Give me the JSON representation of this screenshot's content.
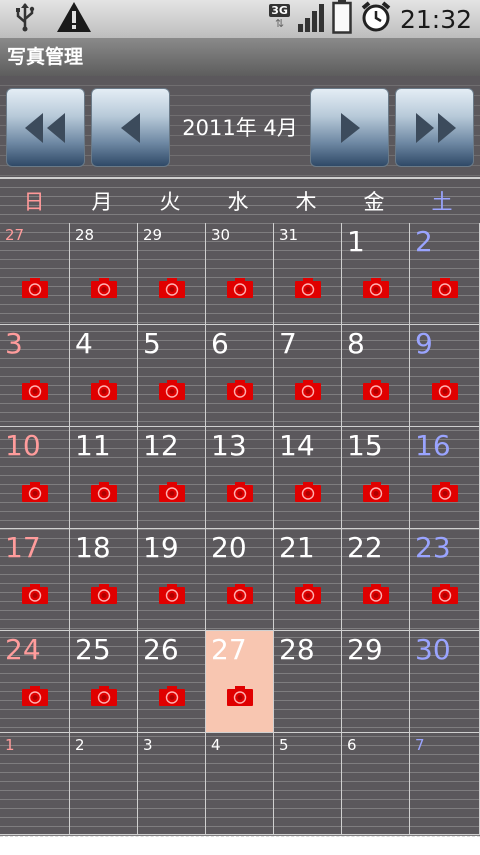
{
  "status_bar": {
    "icons": [
      "usb-icon",
      "warning-icon",
      "signal-icon",
      "battery-icon",
      "alarm-icon"
    ],
    "network": "3G",
    "time": "21:32"
  },
  "app": {
    "title": "写真管理"
  },
  "nav": {
    "month_label": "2011年 4月",
    "buttons": [
      "prev-year",
      "prev-month",
      "next-month",
      "next-year"
    ]
  },
  "calendar": {
    "weekdays": [
      "日",
      "月",
      "火",
      "水",
      "木",
      "金",
      "土"
    ],
    "colors": {
      "sunday": "#ff9c9c",
      "saturday": "#9aa4ff",
      "today_bg": "#f8c6b1",
      "camera": "#e00000"
    },
    "weeks": [
      [
        {
          "day": "27",
          "other": true,
          "photo": true
        },
        {
          "day": "28",
          "other": true,
          "photo": true
        },
        {
          "day": "29",
          "other": true,
          "photo": true
        },
        {
          "day": "30",
          "other": true,
          "photo": true
        },
        {
          "day": "31",
          "other": true,
          "photo": true
        },
        {
          "day": "1",
          "photo": true
        },
        {
          "day": "2",
          "photo": true
        }
      ],
      [
        {
          "day": "3",
          "photo": true
        },
        {
          "day": "4",
          "photo": true
        },
        {
          "day": "5",
          "photo": true
        },
        {
          "day": "6",
          "photo": true
        },
        {
          "day": "7",
          "photo": true
        },
        {
          "day": "8",
          "photo": true
        },
        {
          "day": "9",
          "photo": true
        }
      ],
      [
        {
          "day": "10",
          "photo": true
        },
        {
          "day": "11",
          "photo": true
        },
        {
          "day": "12",
          "photo": true
        },
        {
          "day": "13",
          "photo": true
        },
        {
          "day": "14",
          "photo": true
        },
        {
          "day": "15",
          "photo": true
        },
        {
          "day": "16",
          "photo": true
        }
      ],
      [
        {
          "day": "17",
          "photo": true
        },
        {
          "day": "18",
          "photo": true
        },
        {
          "day": "19",
          "photo": true
        },
        {
          "day": "20",
          "photo": true
        },
        {
          "day": "21",
          "photo": true
        },
        {
          "day": "22",
          "photo": true
        },
        {
          "day": "23",
          "photo": true
        }
      ],
      [
        {
          "day": "24",
          "photo": true
        },
        {
          "day": "25",
          "photo": true
        },
        {
          "day": "26",
          "photo": true
        },
        {
          "day": "27",
          "photo": true,
          "today": true
        },
        {
          "day": "28",
          "photo": false
        },
        {
          "day": "29",
          "photo": false
        },
        {
          "day": "30",
          "photo": false
        }
      ],
      [
        {
          "day": "1",
          "other": true,
          "photo": false
        },
        {
          "day": "2",
          "other": true,
          "photo": false
        },
        {
          "day": "3",
          "other": true,
          "photo": false
        },
        {
          "day": "4",
          "other": true,
          "photo": false
        },
        {
          "day": "5",
          "other": true,
          "photo": false
        },
        {
          "day": "6",
          "other": true,
          "photo": false
        },
        {
          "day": "7",
          "other": true,
          "photo": false
        }
      ]
    ]
  }
}
